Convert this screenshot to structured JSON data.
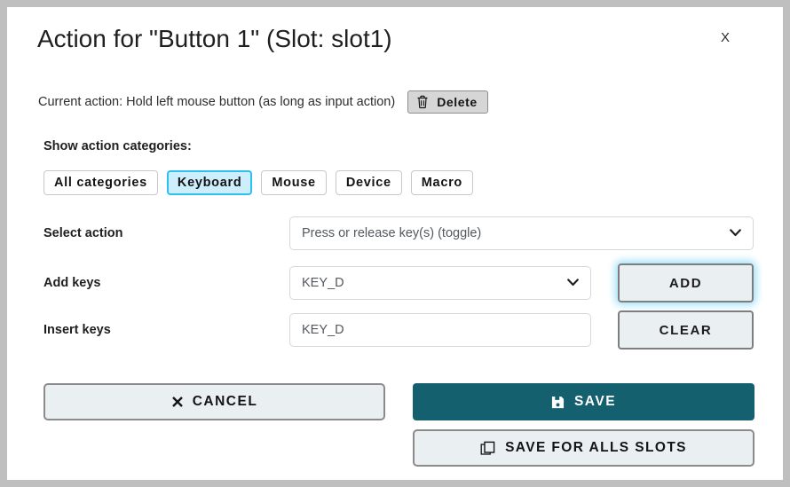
{
  "dialog": {
    "title": "Action for \"Button 1\" (Slot: slot1)",
    "close_label": "X"
  },
  "current_action": {
    "text": "Current action: Hold left mouse button (as long as input action)",
    "delete_label": "Delete",
    "delete_icon": "trash-icon"
  },
  "categories": {
    "label": "Show action categories:",
    "items": [
      {
        "label": "All categories",
        "selected": false
      },
      {
        "label": "Keyboard",
        "selected": true
      },
      {
        "label": "Mouse",
        "selected": false
      },
      {
        "label": "Device",
        "selected": false
      },
      {
        "label": "Macro",
        "selected": false
      }
    ]
  },
  "form": {
    "select_action": {
      "label": "Select action",
      "value": "Press or release key(s) (toggle)",
      "chevron_icon": "chevron-down-icon"
    },
    "add_keys": {
      "label": "Add keys",
      "value": "KEY_D",
      "chevron_icon": "chevron-down-icon",
      "button_label": "ADD"
    },
    "insert_keys": {
      "label": "Insert keys",
      "value": "KEY_D",
      "placeholder": "KEY_D",
      "button_label": "CLEAR"
    }
  },
  "footer": {
    "cancel_label": "CANCEL",
    "cancel_icon": "close-x-icon",
    "save_label": "SAVE",
    "save_icon": "floppy-disk-icon",
    "save_all_label": "SAVE FOR ALLS SLOTS",
    "save_all_icon": "copy-icon"
  },
  "colors": {
    "accent_teal": "#14606f",
    "selected_blue_border": "#2fc0ef",
    "selected_blue_fill": "#cdeefc",
    "focus_glow": "#9fe0fa",
    "frame_gray": "#bfbfbf"
  }
}
